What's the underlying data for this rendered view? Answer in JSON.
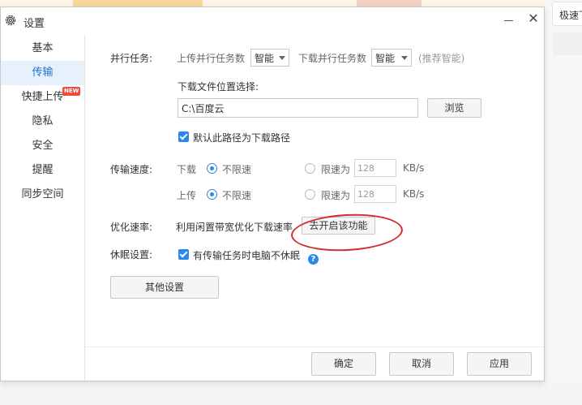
{
  "window": {
    "title": "设置",
    "icons": {
      "settings": "gear-icon",
      "minimize": "minimize-icon",
      "close": "close-icon"
    },
    "close_glyph": "✕"
  },
  "background": {
    "speed_label": "极速下"
  },
  "sidebar": {
    "items": [
      {
        "label": "基本"
      },
      {
        "label": "传输",
        "active": true
      },
      {
        "label": "快捷上传",
        "badge": "NEW"
      },
      {
        "label": "隐私"
      },
      {
        "label": "安全"
      },
      {
        "label": "提醒"
      },
      {
        "label": "同步空间"
      }
    ]
  },
  "parallel": {
    "label": "并行任务:",
    "upload_label": "上传并行任务数",
    "upload_value": "智能",
    "download_label": "下载并行任务数",
    "download_value": "智能",
    "hint": "(推荐智能)"
  },
  "location": {
    "label": "下载文件位置选择:",
    "path": "C:\\百度云",
    "browse_button": "浏览",
    "default_checkbox": "默认此路径为下载路径"
  },
  "speed": {
    "label": "传输速度:",
    "download": {
      "label": "下载",
      "unlimited": "不限速",
      "limit_label": "限速为",
      "limit_value": "128",
      "unit": "KB/s"
    },
    "upload": {
      "label": "上传",
      "unlimited": "不限速",
      "limit_label": "限速为",
      "limit_value": "128",
      "unit": "KB/s"
    }
  },
  "optimize": {
    "label": "优化速率:",
    "description": "利用闲置带宽优化下载速率",
    "button": "去开启该功能"
  },
  "sleep": {
    "label": "休眠设置:",
    "checkbox": "有传输任务时电脑不休眠",
    "help_glyph": "?"
  },
  "other_button": "其他设置",
  "footer": {
    "ok": "确定",
    "cancel": "取消",
    "apply": "应用"
  },
  "colors": {
    "accent": "#2c88e8",
    "active_bg": "#e6f1fc",
    "annotation": "#d42b2b",
    "badge": "#f04b3b"
  }
}
